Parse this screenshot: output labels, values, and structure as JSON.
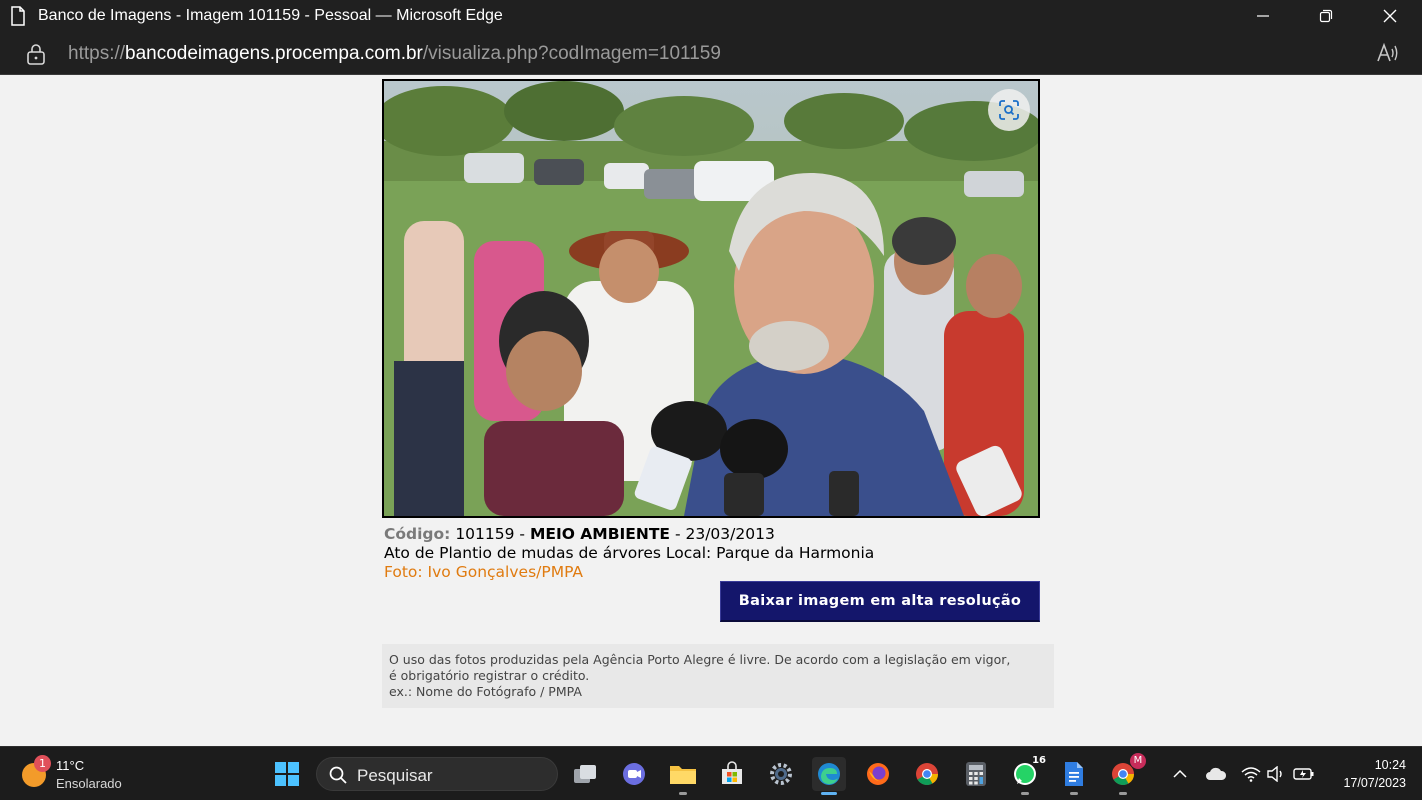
{
  "window": {
    "title": "Banco de Imagens - Imagem 101159 - Pessoal — Microsoft Edge"
  },
  "address": {
    "scheme": "https://",
    "host": "bancodeimagens.procempa.com.br",
    "path": "/visualiza.php?codImagem=101159"
  },
  "photo": {
    "visual_search_icon": "visual-search-icon"
  },
  "info": {
    "code_label": "Código:",
    "code_value": "101159",
    "sep1": " - ",
    "category": "MEIO AMBIENTE",
    "sep2": " - ",
    "date": "23/03/2013",
    "description": "Ato de Plantio de mudas de árvores Local: Parque da Harmonia",
    "credit": "Foto: Ivo Gonçalves/PMPA"
  },
  "download_button": {
    "label": "Baixar imagem em alta resolução"
  },
  "notice": {
    "line1": "O uso das fotos produzidas pela Agência Porto Alegre é livre. De acordo com a legislação em vigor,",
    "line2": "é obrigatório registrar o crédito.",
    "line3": "ex.: Nome do Fotógrafo / PMPA"
  },
  "taskbar": {
    "weather_badge": "1",
    "temperature": "11°C",
    "condition": "Ensolarado",
    "search_placeholder": "Pesquisar",
    "whatsapp_count": "16",
    "chrome_profile_badge": "M",
    "time": "10:24",
    "date": "17/07/2023"
  },
  "colors": {
    "download_button_bg": "#14166b",
    "credit_text": "#e07b10",
    "code_label": "#7a7a7a"
  }
}
